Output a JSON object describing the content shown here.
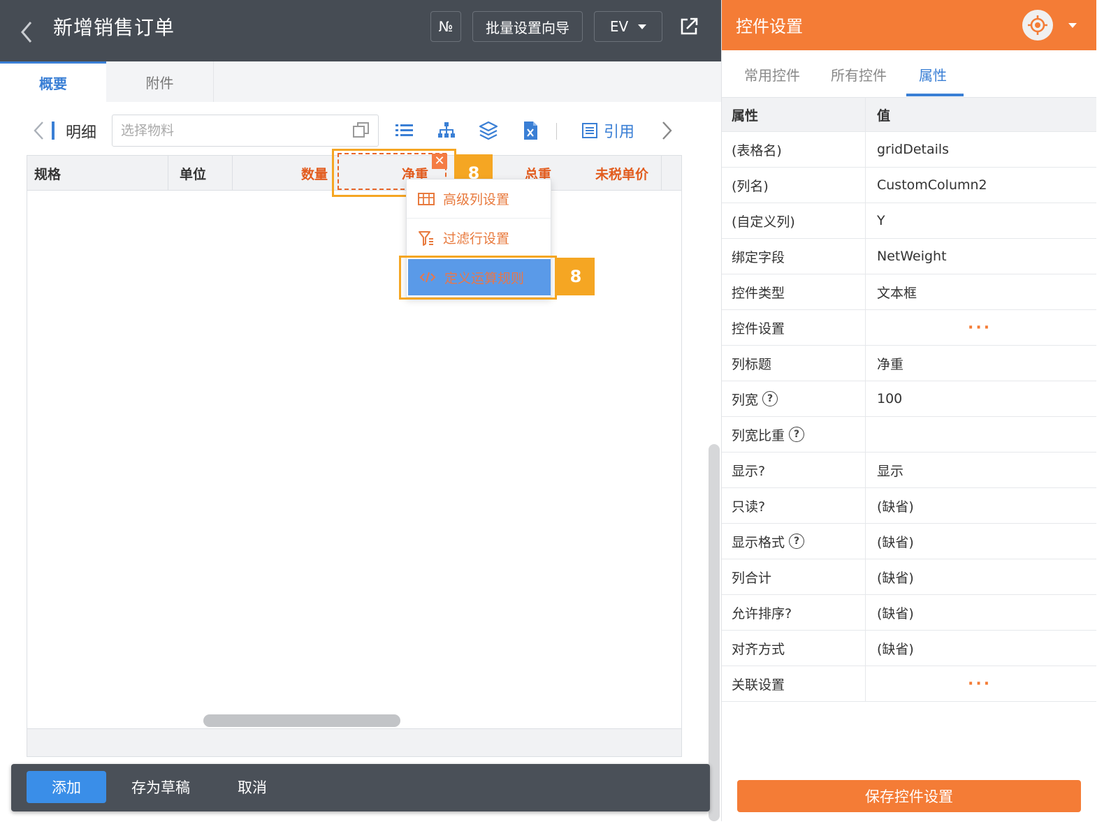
{
  "header": {
    "title": "新增销售订单",
    "no_label": "№",
    "batch_label": "批量设置向导",
    "ev_label": "EV"
  },
  "tabs": [
    {
      "label": "概要"
    },
    {
      "label": "附件"
    }
  ],
  "toolbar": {
    "detail_label": "明细",
    "material_placeholder": "选择物料",
    "cite_label": "引用"
  },
  "grid": {
    "columns": [
      "规格",
      "单位",
      "数量",
      "净重",
      "总重",
      "未税单价"
    ]
  },
  "badges": [
    "8",
    "8"
  ],
  "close_label": "✕",
  "dropdown": {
    "items": [
      "高级列设置",
      "过滤行设置",
      "定义运算规则"
    ]
  },
  "bottom_bar": {
    "add_label": "添加",
    "draft_label": "存为草稿",
    "cancel_label": "取消"
  },
  "panel": {
    "title": "控件设置",
    "tabs": [
      "常用控件",
      "所有控件",
      "属性"
    ],
    "head": {
      "key": "属性",
      "value": "值"
    },
    "rows": [
      {
        "key": "(表格名)",
        "value": "gridDetails"
      },
      {
        "key": "(列名)",
        "value": "CustomColumn2"
      },
      {
        "key": "(自定义列)",
        "value": "Y"
      },
      {
        "key": "绑定字段",
        "value": "NetWeight"
      },
      {
        "key": "控件类型",
        "value": "文本框"
      },
      {
        "key": "控件设置",
        "value": "···"
      },
      {
        "key": "列标题",
        "value": "净重"
      },
      {
        "key": "列宽",
        "value": "100"
      },
      {
        "key": "列宽比重",
        "value": ""
      },
      {
        "key": "显示?",
        "value": "显示"
      },
      {
        "key": "只读?",
        "value": "(缺省)"
      },
      {
        "key": "显示格式",
        "value": "(缺省)"
      },
      {
        "key": "列合计",
        "value": "(缺省)"
      },
      {
        "key": "允许排序?",
        "value": "(缺省)"
      },
      {
        "key": "对齐方式",
        "value": "(缺省)"
      },
      {
        "key": "关联设置",
        "value": "···"
      }
    ],
    "help_mark": "?",
    "save_label": "保存控件设置"
  },
  "colors": {
    "header_bg": "#464c54",
    "accent_orange": "#f47c36",
    "accent_blue": "#3a7fd5",
    "badge": "#f5a623"
  }
}
